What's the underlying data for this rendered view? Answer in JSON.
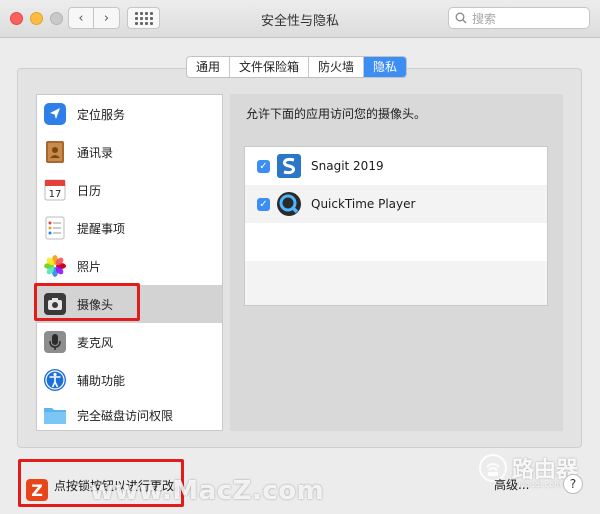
{
  "window": {
    "title": "安全性与隐私",
    "search_placeholder": "搜索"
  },
  "tabs": [
    {
      "label": "通用",
      "active": false
    },
    {
      "label": "文件保险箱",
      "active": false
    },
    {
      "label": "防火墙",
      "active": false
    },
    {
      "label": "隐私",
      "active": true
    }
  ],
  "sidebar": {
    "items": [
      {
        "label": "定位服务",
        "icon": "location-icon"
      },
      {
        "label": "通讯录",
        "icon": "contacts-icon"
      },
      {
        "label": "日历",
        "icon": "calendar-icon",
        "day": "17"
      },
      {
        "label": "提醒事项",
        "icon": "reminders-icon"
      },
      {
        "label": "照片",
        "icon": "photos-icon"
      },
      {
        "label": "摄像头",
        "icon": "camera-icon",
        "selected": true
      },
      {
        "label": "麦克风",
        "icon": "microphone-icon"
      },
      {
        "label": "辅助功能",
        "icon": "accessibility-icon"
      },
      {
        "label": "完全磁盘访问权限",
        "icon": "folder-icon"
      }
    ]
  },
  "right": {
    "caption": "允许下面的应用访问您的摄像头。",
    "apps": [
      {
        "name": "Snagit 2019",
        "checked": true,
        "icon": "snagit-icon"
      },
      {
        "name": "QuickTime Player",
        "checked": true,
        "icon": "quicktime-icon"
      }
    ]
  },
  "bottom": {
    "lock_text": "点按锁按钮以进行更改。",
    "advanced": "高级...",
    "help": "?"
  },
  "watermarks": {
    "site": "www.MacZ.com",
    "logo_letter": "Z",
    "router_brand": "路由器",
    "router_url": "luyouqi.com"
  },
  "colors": {
    "accent": "#3d8ef4",
    "highlight": "#e21b1b"
  }
}
